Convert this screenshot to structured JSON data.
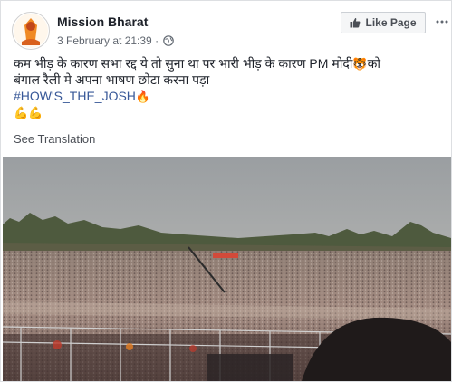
{
  "post": {
    "page_name": "Mission Bharat",
    "date": "3 February at 21:39",
    "separator": "·",
    "like_button_label": "Like Page",
    "text_line1_part1": "कम भीड़ के कारण सभा रद्द ये तो सुना था पर भारी भीड़ के कारण PM मोदी",
    "text_line1_part2": "को",
    "text_line2": "बंगाल रैली मे अपना भाषण छोटा करना पड़ा",
    "hashtag": "#HOW'S_THE_JOSH",
    "emoji_tiger": "🐯",
    "emoji_fire": "🔥",
    "emoji_flex": "💪💪",
    "see_translation": "See Translation"
  }
}
